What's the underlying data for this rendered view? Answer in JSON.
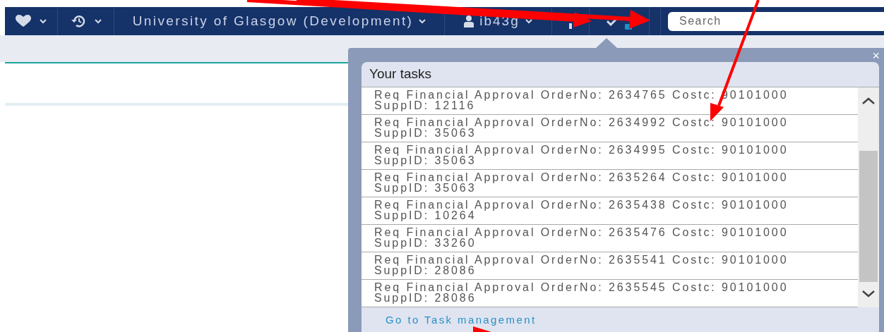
{
  "navbar": {
    "site_menu": {
      "label": "University of Glasgow (Development)"
    },
    "user_menu": {
      "label": "ib43g"
    },
    "search": {
      "placeholder": "Search"
    }
  },
  "tasks_popup": {
    "title": "Your tasks",
    "close": "×",
    "tasks": [
      {
        "title": "Req Financial Approval OrderNo: 2634765 Costc: 90101000",
        "supplier": "SuppID: 12116"
      },
      {
        "title": "Req Financial Approval OrderNo: 2634992 Costc: 90101000",
        "supplier": "SuppID: 35063"
      },
      {
        "title": "Req Financial Approval OrderNo: 2634995 Costc: 90101000",
        "supplier": "SuppID: 35063"
      },
      {
        "title": "Req Financial Approval OrderNo: 2635264 Costc: 90101000",
        "supplier": "SuppID: 35063"
      },
      {
        "title": "Req Financial Approval OrderNo: 2635438 Costc: 90101000",
        "supplier": "SuppID: 10264"
      },
      {
        "title": "Req Financial Approval OrderNo: 2635476 Costc: 90101000",
        "supplier": "SuppID: 33260"
      },
      {
        "title": "Req Financial Approval OrderNo: 2635541 Costc: 90101000",
        "supplier": "SuppID: 28086"
      },
      {
        "title": "Req Financial Approval OrderNo: 2635545 Costc: 90101000",
        "supplier": "SuppID: 28086"
      }
    ],
    "footer_link": "Go to Task management"
  }
}
